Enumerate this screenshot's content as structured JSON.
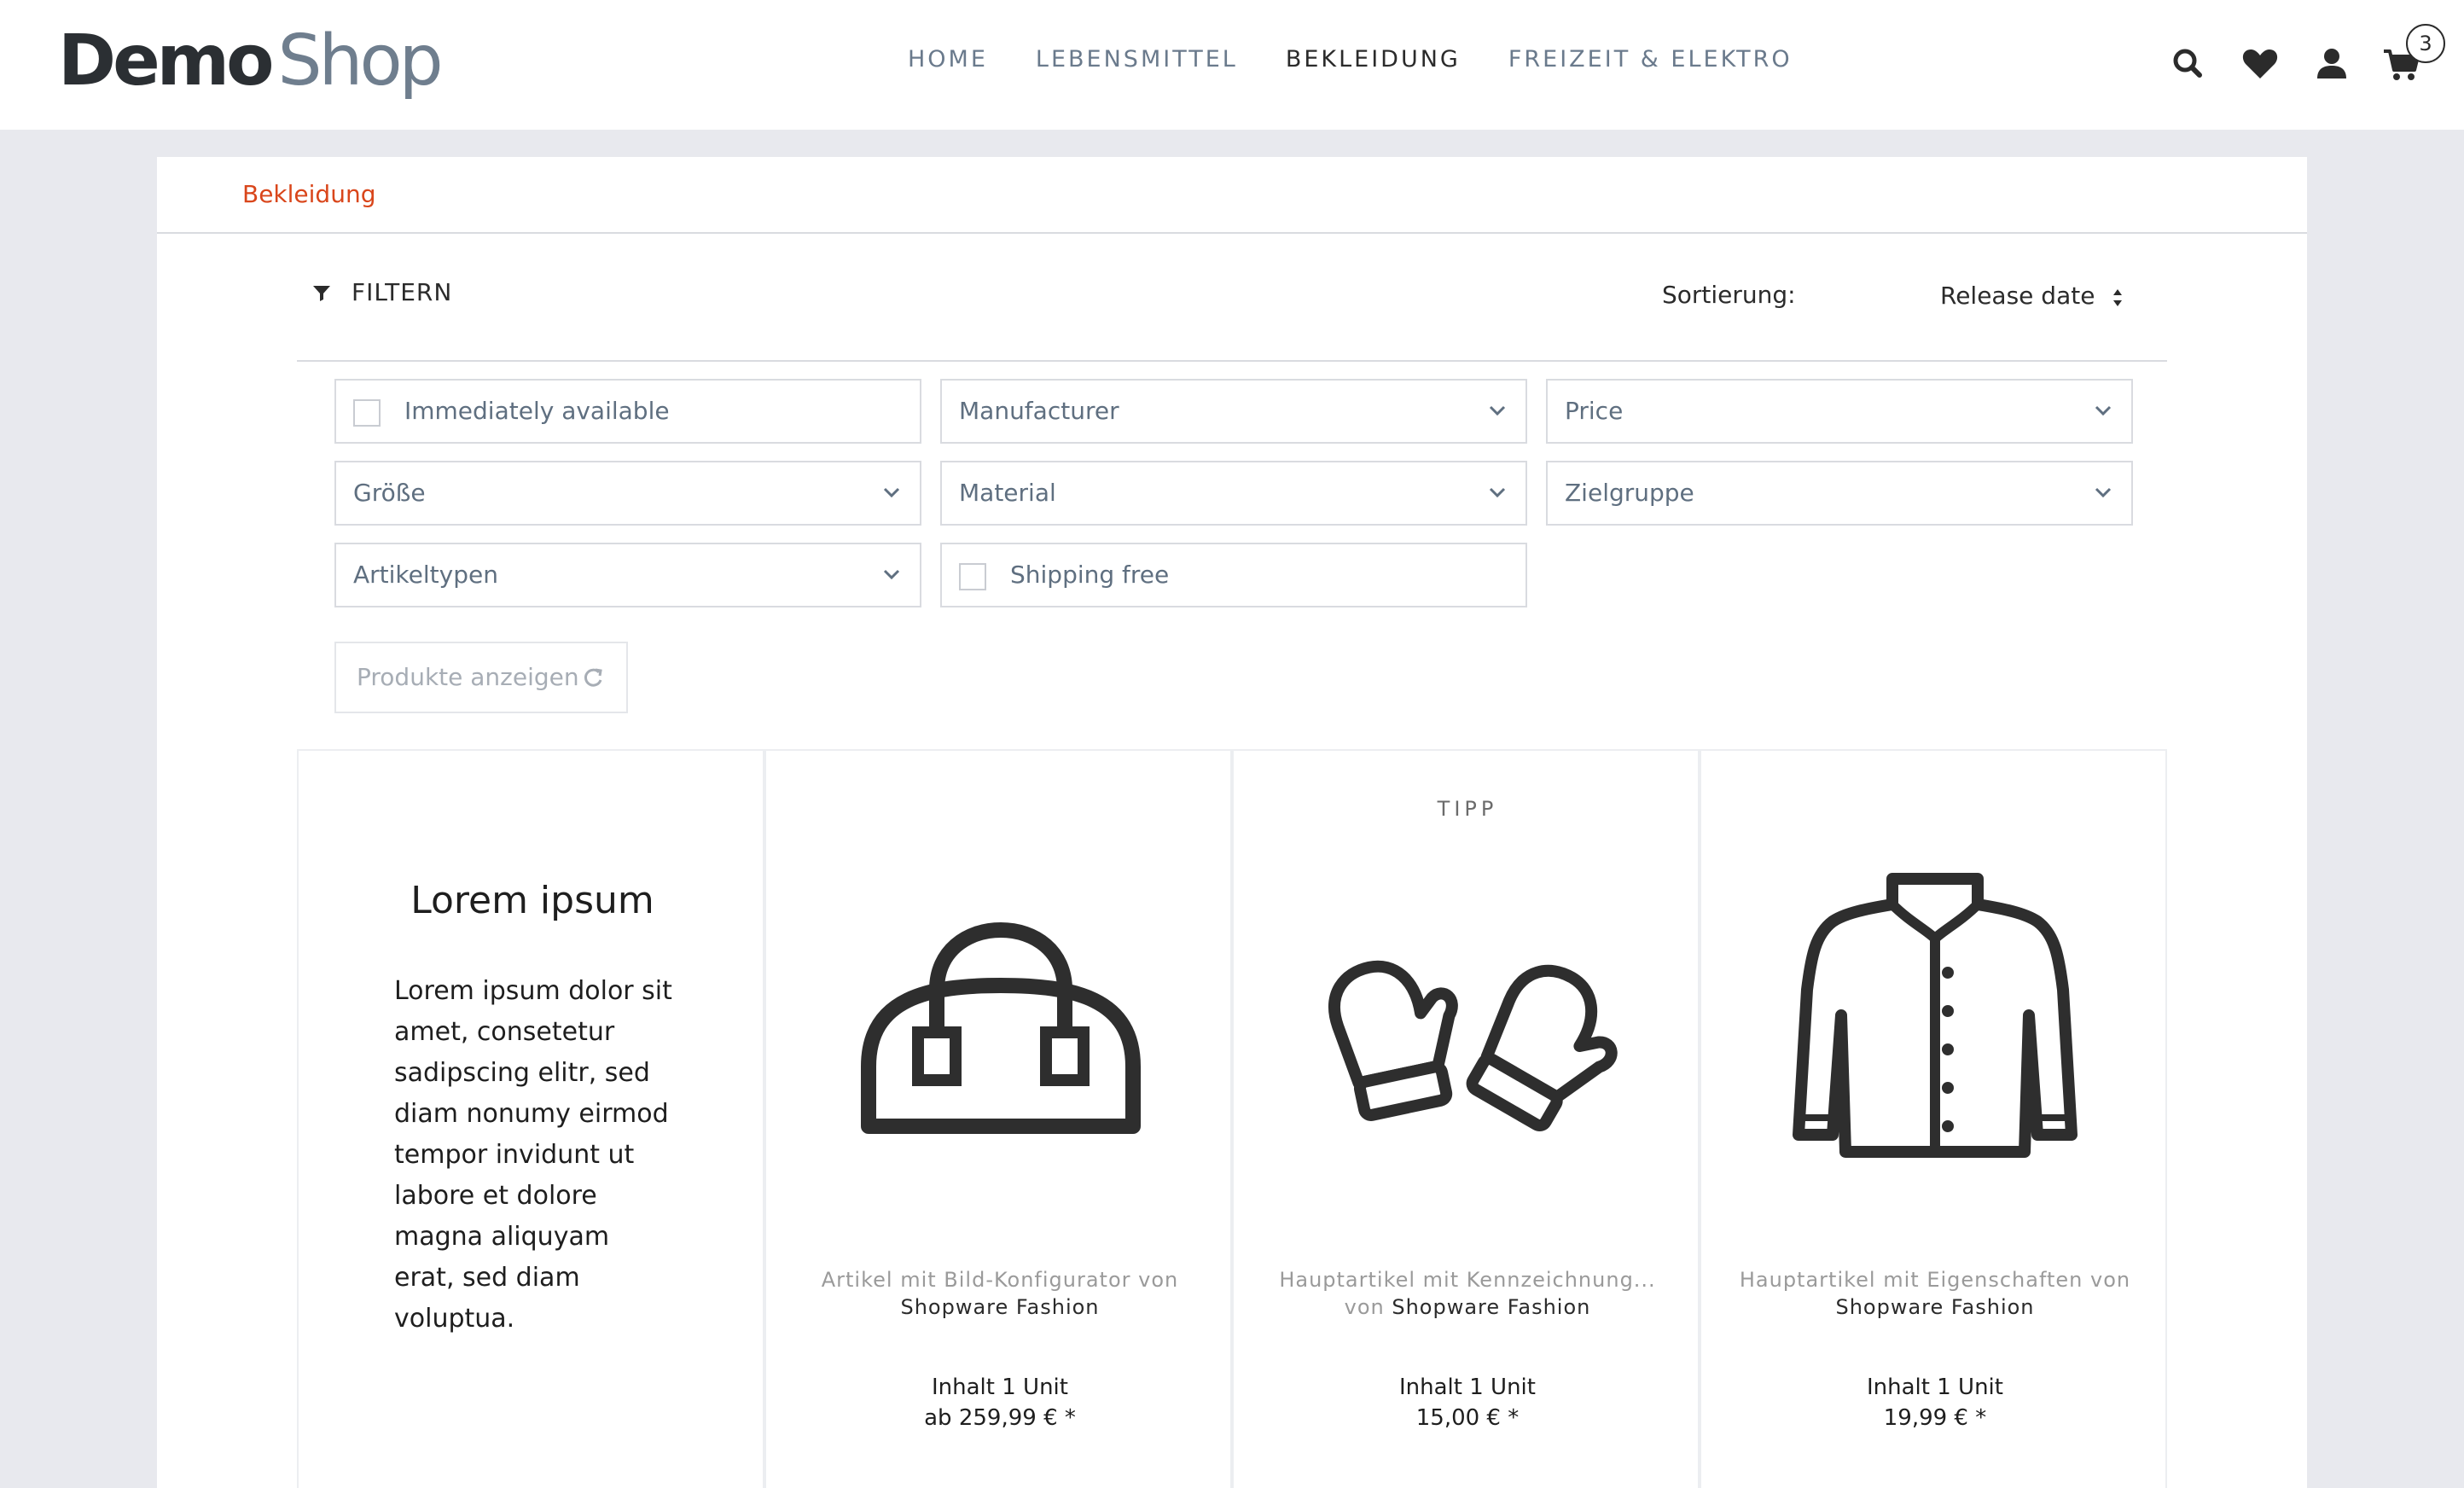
{
  "brand": {
    "logo_part1": "Demo",
    "logo_part2": "Shop"
  },
  "nav": {
    "items": [
      {
        "label": "HOME"
      },
      {
        "label": "LEBENSMITTEL"
      },
      {
        "label": "BEKLEIDUNG",
        "active": true
      },
      {
        "label": "FREIZEIT & ELEKTRO"
      }
    ]
  },
  "header_icons": [
    "search-icon",
    "heart-icon",
    "user-icon",
    "cart-icon"
  ],
  "cart": {
    "count": "3"
  },
  "breadcrumb": {
    "current": "Bekleidung"
  },
  "filter": {
    "toggle_label": "FILTERN"
  },
  "sorting": {
    "label": "Sortierung:",
    "value": "Release date"
  },
  "facets": {
    "immediately_available": "Immediately available",
    "manufacturer": "Manufacturer",
    "price": "Price",
    "size": "Größe",
    "material": "Material",
    "target_group": "Zielgruppe",
    "article_types": "Artikeltypen",
    "shipping_free": "Shipping free"
  },
  "show_products": {
    "label": "Produkte anzeigen"
  },
  "emotion_text": {
    "title": "Lorem ipsum",
    "body": "Lorem ipsum dolor sit amet, consetetur sadipscing elitr, sed diam nonumy eirmod tempor invidunt ut labore et dolore magna aliquyam erat, sed diam voluptua."
  },
  "products": [
    {
      "icon": "bag-icon",
      "badge": "",
      "name": "Artikel mit Bild-Konfigurator von",
      "by": "",
      "brand": "Shopware Fashion",
      "unit": "Inhalt 1 Unit",
      "price": "ab 259,99 € *"
    },
    {
      "icon": "mittens-icon",
      "badge": "TIPP",
      "name": "Hauptartikel mit Kennzeichnung...",
      "by": "von ",
      "brand": "Shopware Fashion",
      "unit": "Inhalt 1 Unit",
      "price": "15,00 € *"
    },
    {
      "icon": "jacket-icon",
      "badge": "",
      "name": "Hauptartikel mit Eigenschaften von",
      "by": "",
      "brand": "Shopware Fashion",
      "unit": "Inhalt 1 Unit",
      "price": "19,99 € *"
    }
  ],
  "colors": {
    "accent": "#d9461b",
    "nav_text": "#6a7a8c",
    "text_dark": "#2b2b2b",
    "border": "#d9dbe0",
    "page_bg": "#e8e9ee"
  }
}
